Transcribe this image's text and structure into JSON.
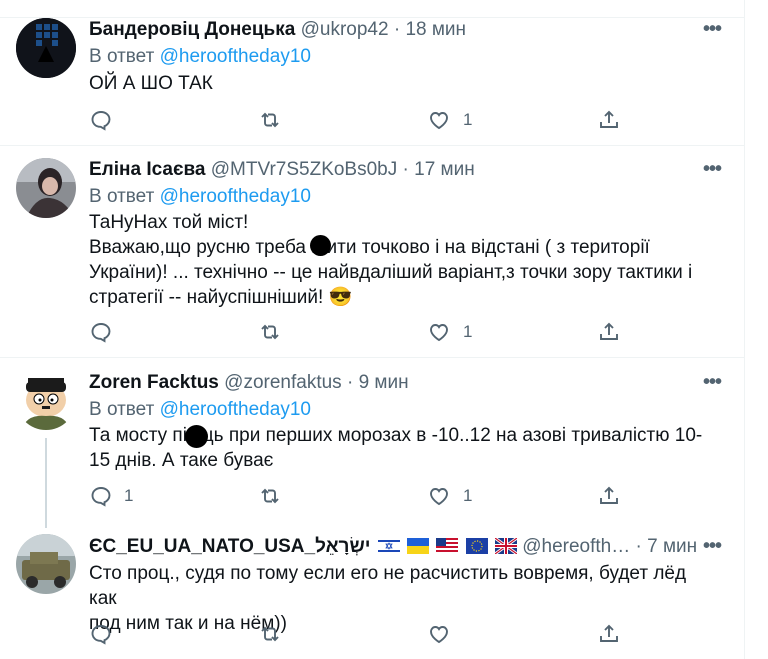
{
  "tweets": [
    {
      "author": "Бандеровiц Донецька",
      "handle": "@ukrop42",
      "time": "18 мин",
      "reply_prefix": "В ответ",
      "reply_to": "@herooftheday10",
      "text": "ОЙ А ШО ТАК",
      "like_count": "1",
      "reply_count": ""
    },
    {
      "author": "Еліна Ісаєва",
      "handle": "@MTVr7S5ZKoBs0bJ",
      "time": "17 мин",
      "reply_prefix": "В ответ",
      "reply_to": "@herooftheday10",
      "lines": [
        "ТаНуНах той міст!",
        "Вважаю,що русню треба  шити точково і на відстані ( з території",
        "України)! ... технічно -- це найвдаліший варіант,з точки зору тактики і",
        "стратегії -- найуспішніший!"
      ],
      "emoji": "😎",
      "like_count": "1",
      "reply_count": ""
    },
    {
      "author": "Zoren Facktus",
      "handle": "@zorenfaktus",
      "time": "9 мин",
      "reply_prefix": "В ответ",
      "reply_to": "@herooftheday10",
      "lines": [
        "Та мосту пі  ець при перших морозах в -10..12 на азові тривалістю 10-",
        "15 днів. А таке буває"
      ],
      "like_count": "1",
      "reply_count": "1"
    },
    {
      "author": "ЄС_EU_UA_NATO_USA_ישְׂרָאֵל",
      "handle": "@herooftheday10",
      "handle_truncated": "@hereofth…",
      "time": "7 мин",
      "lines": [
        "Сто проц., судя по тому если его не расчистить вовремя, будет лёд как",
        "под ним так и на нём))"
      ],
      "like_count": "",
      "reply_count": ""
    }
  ],
  "separator": "·",
  "more_glyph": "•••",
  "colors": {
    "link": "#1d9bf0",
    "muted": "#536471",
    "border": "#eff3f4"
  },
  "icons": [
    "reply-icon",
    "retweet-icon",
    "like-icon",
    "share-icon",
    "more-icon"
  ]
}
